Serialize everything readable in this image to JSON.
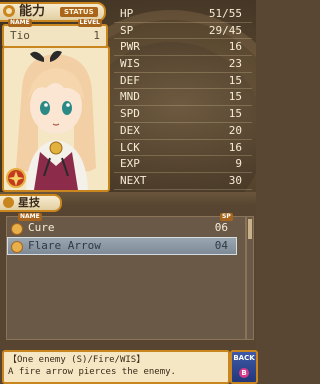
{
  "top": {
    "title": "能力",
    "status_tag": "STATUS",
    "name_label": "NAME",
    "level_label": "LEVEL",
    "name": "Tio",
    "level": "1",
    "stats": [
      {
        "key": "HP",
        "value": "51/55"
      },
      {
        "key": "SP",
        "value": "29/45"
      },
      {
        "key": "PWR",
        "value": "16"
      },
      {
        "key": "WIS",
        "value": "23"
      },
      {
        "key": "DEF",
        "value": "15"
      },
      {
        "key": "MND",
        "value": "15"
      },
      {
        "key": "SPD",
        "value": "15"
      },
      {
        "key": "DEX",
        "value": "20"
      },
      {
        "key": "LCK",
        "value": "16"
      },
      {
        "key": "EXP",
        "value": "9"
      },
      {
        "key": "NEXT",
        "value": "30"
      }
    ]
  },
  "bottom": {
    "tab_label": "星技",
    "col_name": "NAME",
    "col_sp": "SP",
    "skills": [
      {
        "name": "Cure",
        "sp": "06",
        "selected": false
      },
      {
        "name": "Flare Arrow",
        "sp": "04",
        "selected": true
      }
    ],
    "description": {
      "line1": "【One enemy (S)/Fire/WIS】",
      "line2": "A fire arrow pierces the enemy."
    },
    "back_button": {
      "label": "BACK",
      "key": "B"
    }
  },
  "colors": {
    "frame_gold": "#c9861f",
    "parchment": "#f5e7c4",
    "panel_brown": "#574531",
    "selected_row": "#8c97a1",
    "back_blue": "#2f4a93"
  }
}
